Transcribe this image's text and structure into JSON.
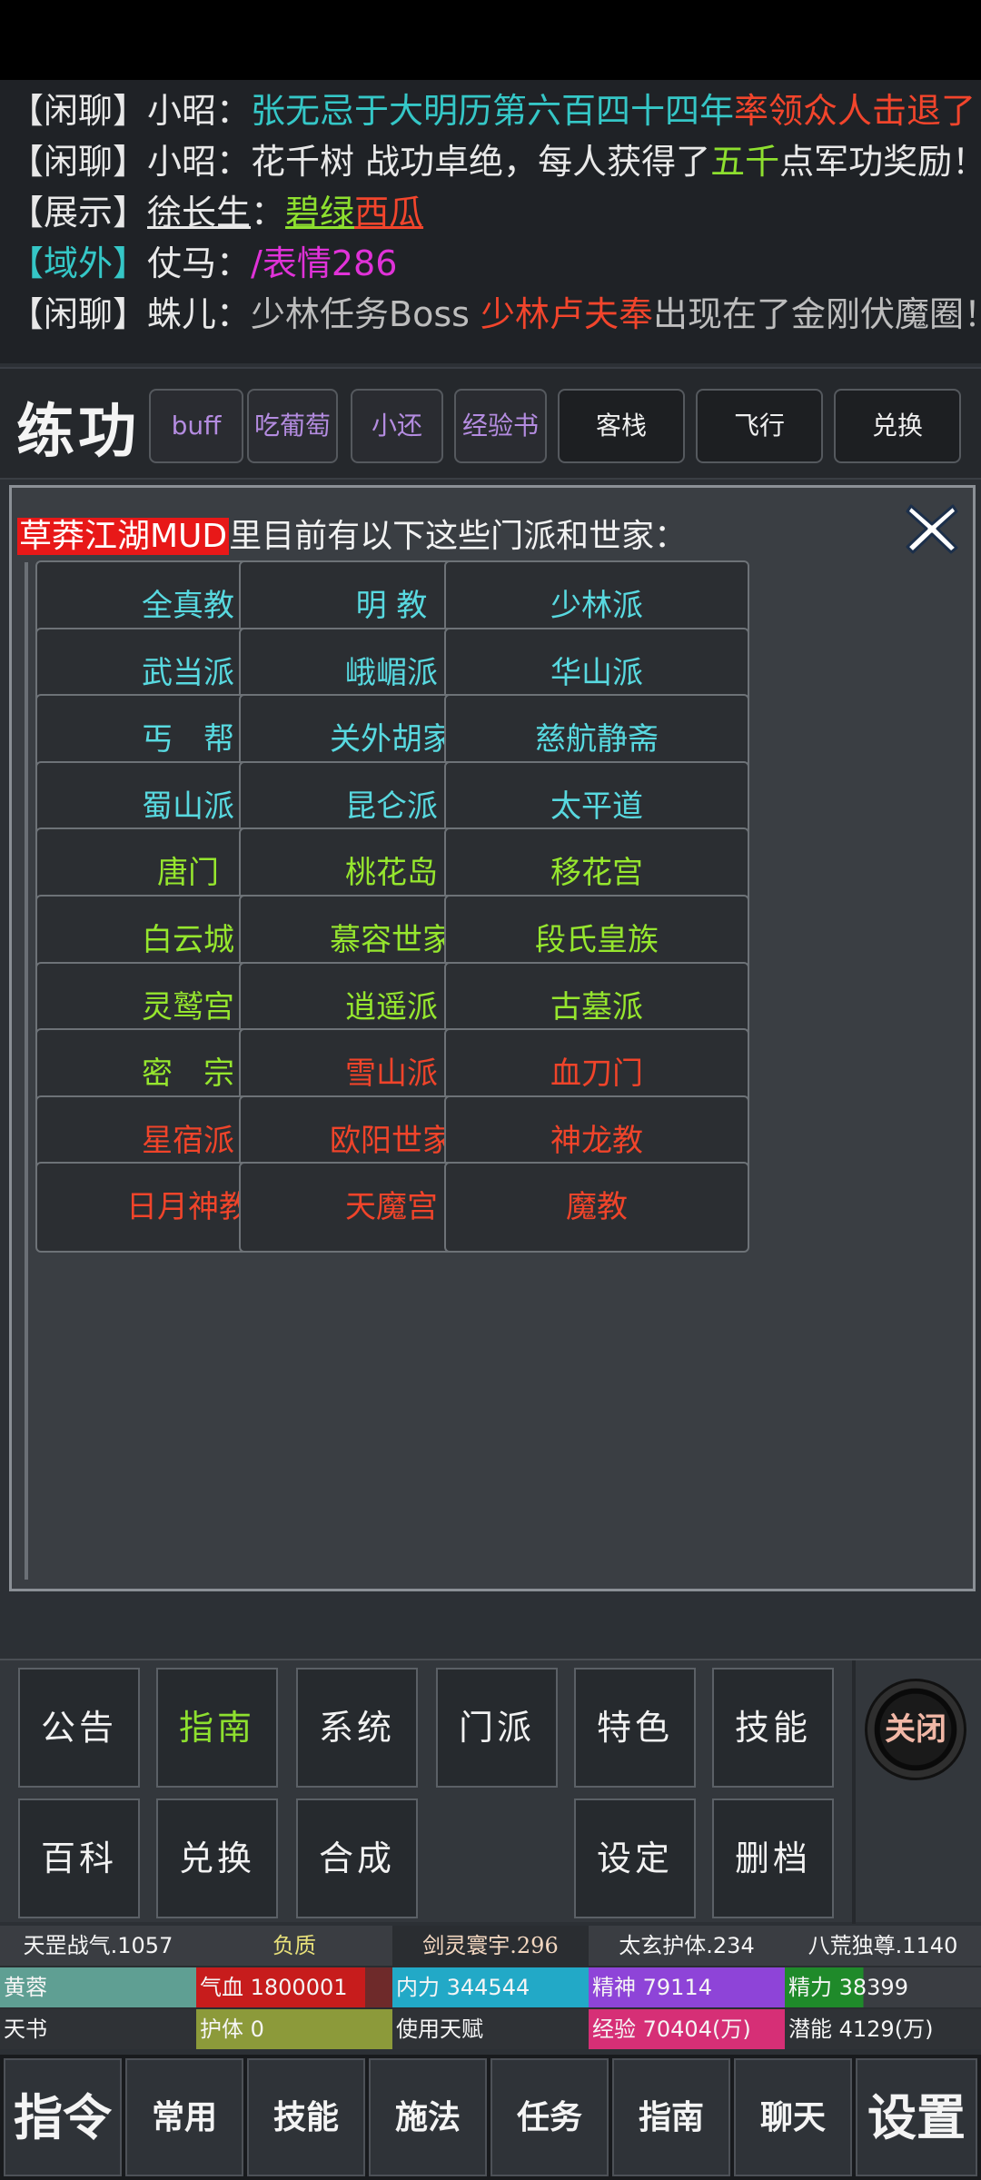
{
  "chat": [
    {
      "tag": "【闲聊】",
      "speaker": "小昭：",
      "p1": "张无忌于大明历第六百四十四年",
      "p2": "率领众人击退了",
      "p3": ""
    },
    {
      "tag": "【闲聊】",
      "speaker": "小昭：",
      "p1": "花千树 战功卓绝，每人获得了",
      "p2": "五千",
      "p3": "点军功奖励！"
    },
    {
      "tag": "【展示】",
      "speaker": "徐长生",
      "p1": "：",
      "p2": "碧绿",
      "p3": "西瓜"
    },
    {
      "tag": "【域外】",
      "speaker": "仗马：",
      "p1": "",
      "p2": "/表情286",
      "p3": ""
    },
    {
      "tag": "【闲聊】",
      "speaker": "蛛儿：",
      "p1": "少林任务Boss ",
      "p2": "少林卢夫奉",
      "p3": "出现在了金刚伏魔圈！"
    }
  ],
  "practice": {
    "title": "练功",
    "buttons": [
      "buff",
      "吃葡萄",
      "小还",
      "经验书",
      "客栈",
      "飞行",
      "兑换"
    ]
  },
  "panel": {
    "heading_highlight": "草莽江湖MUD",
    "heading_rest": "里目前有以下这些门派和世家：",
    "factions": [
      "全真教",
      "明 教",
      "少林派",
      "武当派",
      "峨嵋派",
      "华山派",
      "丐　帮",
      "关外胡家",
      "慈航静斋",
      "蜀山派",
      "昆仑派",
      "太平道",
      "唐门",
      "桃花岛",
      "移花宫",
      "白云城",
      "慕容世家",
      "段氏皇族",
      "灵鹫宫",
      "逍遥派",
      "古墓派",
      "密　宗",
      "雪山派",
      "血刀门",
      "星宿派",
      "欧阳世家",
      "神龙教",
      "日月神教",
      "天魔宫",
      "魔教"
    ]
  },
  "menu": {
    "row1": [
      "公告",
      "指南",
      "系统",
      "门派",
      "特色",
      "技能"
    ],
    "row2": [
      "百科",
      "兑换",
      "合成",
      "",
      "设定",
      "删档"
    ],
    "close": "关闭"
  },
  "stats": {
    "row1": [
      "天罡战气.1057",
      "负质",
      "剑灵寰宇.296",
      "太玄护体.234",
      "八荒独尊.1140"
    ],
    "name": "黄蓉",
    "qixue": "气血 1800001",
    "neili": "内力 344544",
    "jingshen": "精神 79114",
    "jingli": "精力 38399",
    "tianshu": "天书",
    "huti": "护体 0",
    "tianfu": "使用天赋",
    "jingyan": "经验 70404(万)",
    "qianneng": "潜能 4129(万)"
  },
  "nav": [
    "指令",
    "常用",
    "技能",
    "施法",
    "任务",
    "指南",
    "聊天",
    "设置"
  ]
}
